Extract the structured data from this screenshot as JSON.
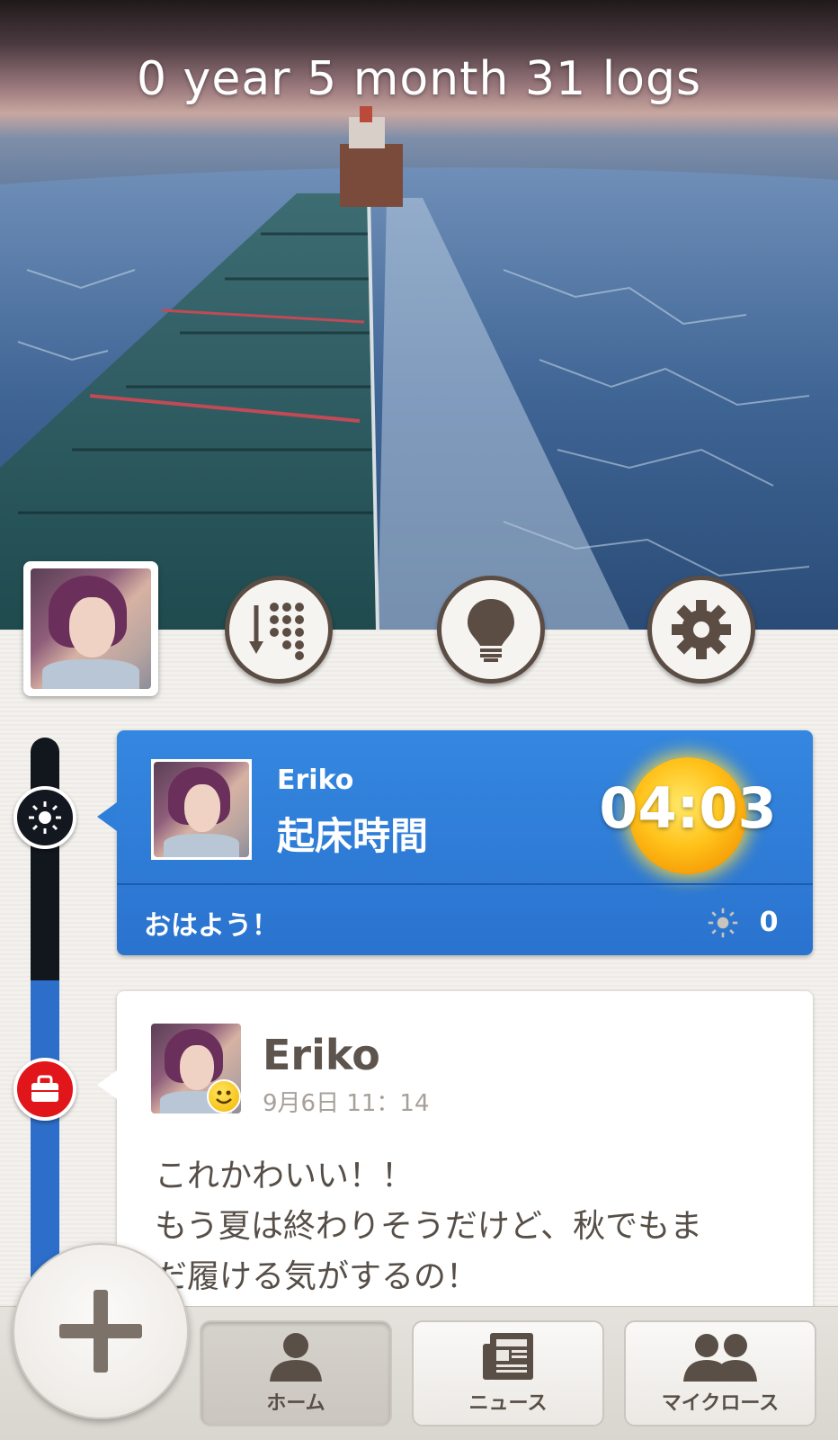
{
  "hero": {
    "title": "0 year 5 month 31 logs"
  },
  "actions": [
    {
      "icon": "sort-icon"
    },
    {
      "icon": "lightbulb-icon"
    },
    {
      "icon": "gear-icon"
    }
  ],
  "wake_post": {
    "user": "Eriko",
    "type_label": "起床時間",
    "time": "04:03",
    "greeting": "おはよう！",
    "like_count": "0"
  },
  "post": {
    "user": "Eriko",
    "date": "9月6日 11：14",
    "body_lines": [
      "これかわいい！！",
      "もう夏は終わりそうだけど、秋でもま",
      "だ履ける気がするの！"
    ]
  },
  "nav": {
    "tabs": [
      {
        "label": "ホーム",
        "icon": "person-icon",
        "active": true
      },
      {
        "label": "ニュース",
        "icon": "newspaper-icon",
        "active": false
      },
      {
        "label": "マイクロース",
        "icon": "people-icon",
        "active": false
      }
    ]
  },
  "colors": {
    "accent_blue": "#2f7ed9",
    "timeline_dark": "#12161d",
    "timeline_blue": "#2c6ec9",
    "bag_red": "#e0161b",
    "icon_brown": "#5b4d44"
  }
}
